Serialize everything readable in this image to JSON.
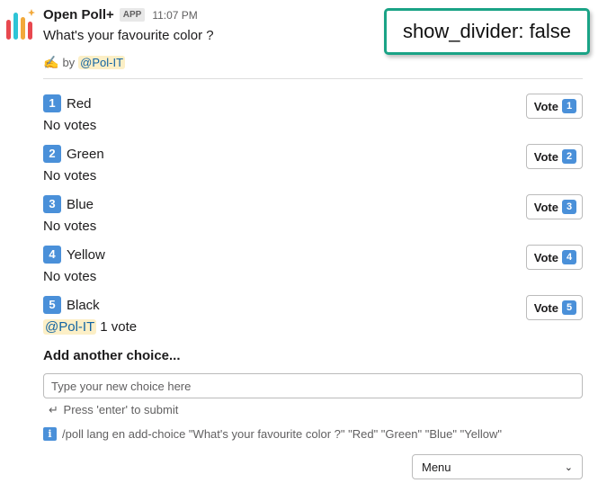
{
  "message": {
    "app_name": "Open Poll+",
    "app_badge": "APP",
    "timestamp": "11:07 PM",
    "question": "What's your favourite color ?",
    "author_prefix": "by",
    "author_mention": "@Pol-IT"
  },
  "overlay": {
    "label": "show_divider: false"
  },
  "choices": [
    {
      "number": "1",
      "label": "Red",
      "votes_text": "No votes",
      "voter": "",
      "vote_button": "Vote"
    },
    {
      "number": "2",
      "label": "Green",
      "votes_text": "No votes",
      "voter": "",
      "vote_button": "Vote"
    },
    {
      "number": "3",
      "label": "Blue",
      "votes_text": "No votes",
      "voter": "",
      "vote_button": "Vote"
    },
    {
      "number": "4",
      "label": "Yellow",
      "votes_text": "No votes",
      "voter": "",
      "vote_button": "Vote"
    },
    {
      "number": "5",
      "label": "Black",
      "votes_text": "1 vote",
      "voter": "@Pol-IT",
      "vote_button": "Vote"
    }
  ],
  "add_choice": {
    "heading": "Add another choice...",
    "placeholder": "Type your new choice here",
    "hint": "Press 'enter' to submit"
  },
  "command": {
    "text": "/poll lang en add-choice \"What's your favourite color ?\" \"Red\" \"Green\" \"Blue\" \"Yellow\""
  },
  "menu": {
    "label": "Menu"
  },
  "icons": {
    "logo": "open-poll-logo",
    "author": "writing-hand-icon",
    "info": "info-icon",
    "enter": "return-arrow-icon",
    "chevron": "chevron-down-icon"
  },
  "colors": {
    "accent": "#4a90d9",
    "mention_bg": "#fcefc6",
    "overlay_border": "#1aa386"
  }
}
